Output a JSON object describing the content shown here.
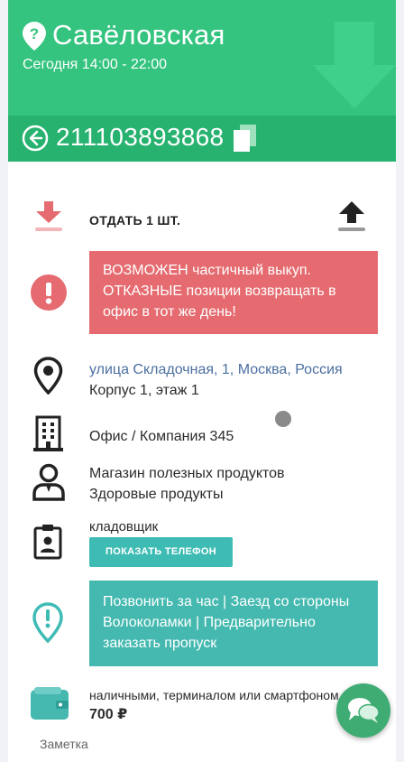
{
  "header": {
    "title": "Савёловская",
    "subtitle": "Сегодня 14:00 - 22:00"
  },
  "order": {
    "number": "211103893868"
  },
  "delivery": {
    "give_label": "ОТДАТЬ 1 ШТ."
  },
  "alert": {
    "text": "ВОЗМОЖЕН частичный выкуп. ОТКАЗНЫЕ позиции возвращать в офис в тот же день!"
  },
  "address": {
    "street": "улица Складочная, 1, Москва, Россия",
    "building": "Корпус 1, этаж 1"
  },
  "office": {
    "text": "Офис / Компания 345"
  },
  "recipient": {
    "line1": "Магазин полезных продуктов",
    "line2": "Здоровые продукты"
  },
  "contact": {
    "role": "кладовщик",
    "show_phone_label": "ПОКАЗАТЬ ТЕЛЕФОН"
  },
  "instructions": {
    "text": "Позвонить за час | Заезд со стороны Волоколамки | Предварительно заказать пропуск"
  },
  "payment": {
    "methods": "наличными, терминалом или смартфоном",
    "amount": "700 ₽"
  },
  "note": {
    "label": "Заметка"
  },
  "colors": {
    "header": "#34c47f",
    "subheader": "#27b26f",
    "alert": "#e56b70",
    "teal": "#45b9b0",
    "chat": "#3fac73"
  }
}
